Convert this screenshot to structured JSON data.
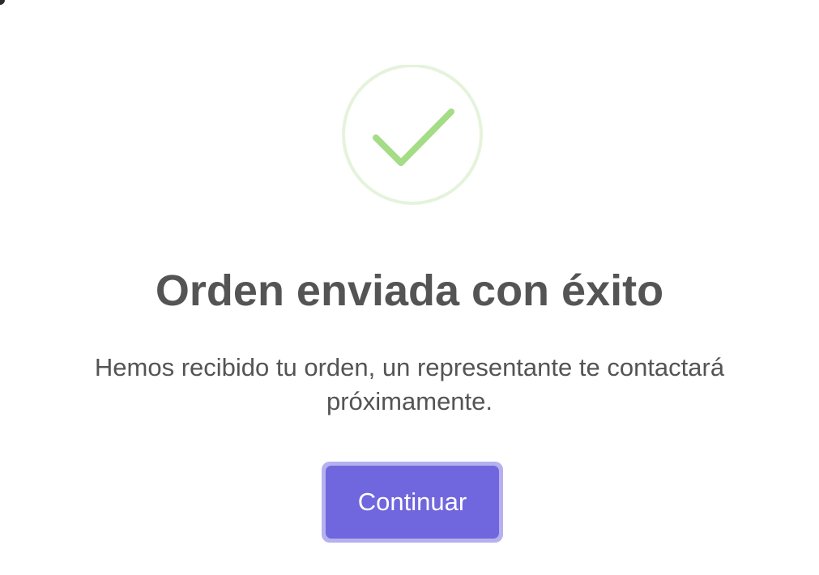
{
  "dialog": {
    "icon": "success-check-icon",
    "title": "Orden enviada con éxito",
    "message": "Hemos recibido tu orden, un representante te contactará próximamente.",
    "confirm_label": "Continuar"
  },
  "colors": {
    "icon_ring": "#e6f3dc",
    "icon_check": "#a5dc86",
    "title_text": "#545454",
    "button_bg": "#7066dd",
    "button_focus_ring": "#b6b1ee",
    "button_text": "#ffffff"
  }
}
